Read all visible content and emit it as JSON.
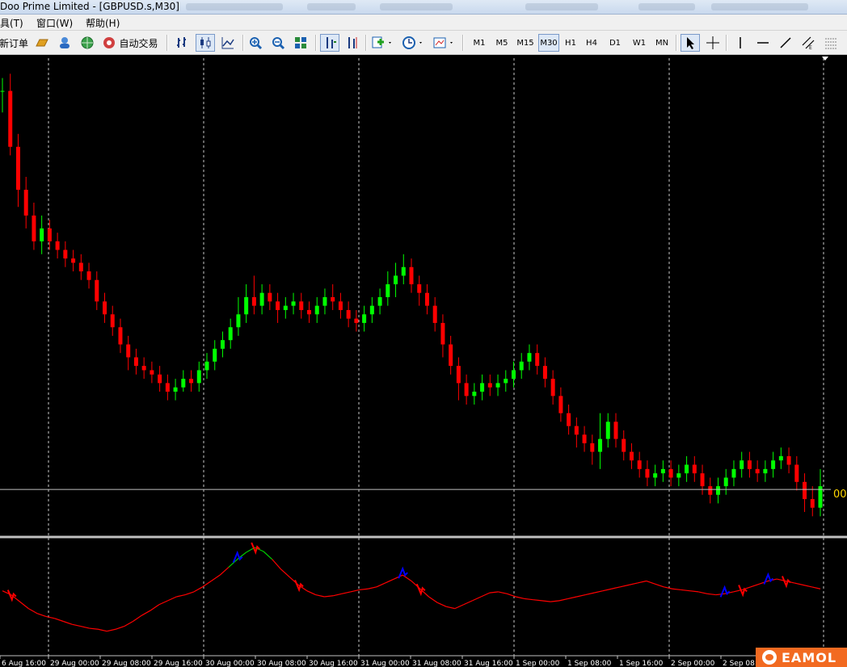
{
  "window": {
    "title": "Doo Prime Limited - [GBPUSD.s,M30]"
  },
  "menu": {
    "items": [
      "具(T)",
      "窗口(W)",
      "帮助(H)"
    ]
  },
  "toolbar": {
    "new_order_label": "新订单",
    "autotrade_label": "自动交易",
    "timeframes": [
      "M1",
      "M5",
      "M15",
      "M30",
      "H1",
      "H4",
      "D1",
      "W1",
      "MN"
    ],
    "active_timeframe": "M30"
  },
  "chart_data": {
    "type": "candlestick",
    "symbol": "GBPUSD.s",
    "timeframe": "M30",
    "price_label": "00",
    "colors": {
      "bull": "#00ff00",
      "bear": "#ff0000",
      "grid": "#c8c8c8",
      "price_line": "#c0c0c0",
      "price_label": "#ffd700",
      "indicator": "#ff0000",
      "indicator_high": "#00cc00",
      "signal_buy": "#0000ff"
    },
    "x_ticks": [
      "6 Aug 16:00",
      "29 Aug 00:00",
      "29 Aug 08:00",
      "29 Aug 16:00",
      "30 Aug 00:00",
      "30 Aug 08:00",
      "30 Aug 16:00",
      "31 Aug 00:00",
      "31 Aug 08:00",
      "31 Aug 16:00",
      "1 Sep 00:00",
      "1 Sep 08:00",
      "1 Sep 16:00",
      "2 Sep 00:00",
      "2 Sep 08:00"
    ],
    "candles": [
      [
        0.95,
        0.95,
        0.98,
        0.9
      ],
      [
        0.95,
        0.82,
        0.99,
        0.8
      ],
      [
        0.82,
        0.72,
        0.85,
        0.68
      ],
      [
        0.72,
        0.66,
        0.75,
        0.63
      ],
      [
        0.66,
        0.6,
        0.69,
        0.58
      ],
      [
        0.6,
        0.63,
        0.66,
        0.57
      ],
      [
        0.63,
        0.6,
        0.65,
        0.58
      ],
      [
        0.6,
        0.58,
        0.62,
        0.56
      ],
      [
        0.58,
        0.56,
        0.6,
        0.54
      ],
      [
        0.56,
        0.55,
        0.58,
        0.53
      ],
      [
        0.55,
        0.53,
        0.57,
        0.51
      ],
      [
        0.53,
        0.51,
        0.55,
        0.49
      ],
      [
        0.51,
        0.46,
        0.53,
        0.44
      ],
      [
        0.46,
        0.43,
        0.48,
        0.41
      ],
      [
        0.43,
        0.4,
        0.45,
        0.38
      ],
      [
        0.4,
        0.36,
        0.42,
        0.34
      ],
      [
        0.36,
        0.33,
        0.38,
        0.3
      ],
      [
        0.33,
        0.31,
        0.35,
        0.29
      ],
      [
        0.31,
        0.3,
        0.33,
        0.28
      ],
      [
        0.3,
        0.29,
        0.32,
        0.27
      ],
      [
        0.29,
        0.27,
        0.31,
        0.25
      ],
      [
        0.27,
        0.25,
        0.29,
        0.23
      ],
      [
        0.25,
        0.26,
        0.28,
        0.23
      ],
      [
        0.26,
        0.28,
        0.3,
        0.25
      ],
      [
        0.28,
        0.27,
        0.3,
        0.25
      ],
      [
        0.27,
        0.3,
        0.32,
        0.25
      ],
      [
        0.3,
        0.32,
        0.34,
        0.28
      ],
      [
        0.32,
        0.35,
        0.37,
        0.3
      ],
      [
        0.35,
        0.37,
        0.39,
        0.33
      ],
      [
        0.37,
        0.4,
        0.42,
        0.35
      ],
      [
        0.4,
        0.43,
        0.47,
        0.38
      ],
      [
        0.43,
        0.47,
        0.5,
        0.41
      ],
      [
        0.47,
        0.45,
        0.52,
        0.43
      ],
      [
        0.45,
        0.48,
        0.5,
        0.43
      ],
      [
        0.48,
        0.46,
        0.5,
        0.44
      ],
      [
        0.46,
        0.44,
        0.48,
        0.41
      ],
      [
        0.44,
        0.45,
        0.47,
        0.42
      ],
      [
        0.45,
        0.46,
        0.48,
        0.43
      ],
      [
        0.46,
        0.44,
        0.48,
        0.42
      ],
      [
        0.44,
        0.43,
        0.46,
        0.41
      ],
      [
        0.43,
        0.45,
        0.47,
        0.41
      ],
      [
        0.45,
        0.47,
        0.49,
        0.43
      ],
      [
        0.47,
        0.46,
        0.5,
        0.44
      ],
      [
        0.46,
        0.44,
        0.48,
        0.42
      ],
      [
        0.44,
        0.42,
        0.46,
        0.4
      ],
      [
        0.42,
        0.41,
        0.44,
        0.39
      ],
      [
        0.41,
        0.43,
        0.45,
        0.39
      ],
      [
        0.43,
        0.45,
        0.47,
        0.41
      ],
      [
        0.45,
        0.47,
        0.49,
        0.43
      ],
      [
        0.47,
        0.5,
        0.53,
        0.45
      ],
      [
        0.5,
        0.52,
        0.55,
        0.47
      ],
      [
        0.52,
        0.54,
        0.57,
        0.5
      ],
      [
        0.54,
        0.5,
        0.56,
        0.48
      ],
      [
        0.5,
        0.48,
        0.52,
        0.45
      ],
      [
        0.48,
        0.45,
        0.5,
        0.43
      ],
      [
        0.45,
        0.41,
        0.47,
        0.39
      ],
      [
        0.41,
        0.36,
        0.43,
        0.33
      ],
      [
        0.36,
        0.31,
        0.38,
        0.29
      ],
      [
        0.31,
        0.27,
        0.33,
        0.23
      ],
      [
        0.27,
        0.24,
        0.29,
        0.22
      ],
      [
        0.24,
        0.25,
        0.27,
        0.22
      ],
      [
        0.25,
        0.27,
        0.29,
        0.23
      ],
      [
        0.27,
        0.26,
        0.29,
        0.24
      ],
      [
        0.26,
        0.27,
        0.29,
        0.24
      ],
      [
        0.27,
        0.28,
        0.3,
        0.25
      ],
      [
        0.28,
        0.3,
        0.32,
        0.26
      ],
      [
        0.3,
        0.32,
        0.34,
        0.28
      ],
      [
        0.32,
        0.34,
        0.36,
        0.3
      ],
      [
        0.34,
        0.31,
        0.36,
        0.29
      ],
      [
        0.31,
        0.28,
        0.33,
        0.26
      ],
      [
        0.28,
        0.24,
        0.3,
        0.22
      ],
      [
        0.24,
        0.2,
        0.26,
        0.18
      ],
      [
        0.2,
        0.17,
        0.22,
        0.15
      ],
      [
        0.17,
        0.15,
        0.19,
        0.12
      ],
      [
        0.15,
        0.13,
        0.17,
        0.11
      ],
      [
        0.13,
        0.11,
        0.15,
        0.08
      ],
      [
        0.11,
        0.14,
        0.2,
        0.07
      ],
      [
        0.14,
        0.18,
        0.2,
        0.12
      ],
      [
        0.18,
        0.14,
        0.2,
        0.12
      ],
      [
        0.14,
        0.11,
        0.16,
        0.09
      ],
      [
        0.11,
        0.09,
        0.13,
        0.07
      ],
      [
        0.09,
        0.07,
        0.11,
        0.05
      ],
      [
        0.07,
        0.05,
        0.09,
        0.03
      ],
      [
        0.05,
        0.06,
        0.08,
        0.03
      ],
      [
        0.06,
        0.07,
        0.09,
        0.04
      ],
      [
        0.07,
        0.05,
        0.09,
        0.03
      ],
      [
        0.05,
        0.06,
        0.08,
        0.03
      ],
      [
        0.06,
        0.08,
        0.1,
        0.04
      ],
      [
        0.08,
        0.06,
        0.1,
        0.04
      ],
      [
        0.06,
        0.03,
        0.08,
        0.01
      ],
      [
        0.03,
        0.01,
        0.05,
        -0.01
      ],
      [
        0.01,
        0.03,
        0.05,
        -0.01
      ],
      [
        0.03,
        0.05,
        0.07,
        0.01
      ],
      [
        0.05,
        0.07,
        0.09,
        0.03
      ],
      [
        0.07,
        0.09,
        0.11,
        0.05
      ],
      [
        0.09,
        0.07,
        0.11,
        0.05
      ],
      [
        0.07,
        0.06,
        0.09,
        0.04
      ],
      [
        0.06,
        0.07,
        0.09,
        0.04
      ],
      [
        0.07,
        0.09,
        0.11,
        0.05
      ],
      [
        0.09,
        0.1,
        0.12,
        0.07
      ],
      [
        0.1,
        0.08,
        0.12,
        0.06
      ],
      [
        0.08,
        0.04,
        0.1,
        0.02
      ],
      [
        0.04,
        0.0,
        0.06,
        -0.03
      ],
      [
        0.0,
        -0.02,
        0.03,
        -0.04
      ],
      [
        -0.02,
        0.03,
        0.07,
        -0.04
      ]
    ],
    "indicator": [
      0.56,
      0.52,
      0.45,
      0.38,
      0.33,
      0.3,
      0.28,
      0.25,
      0.22,
      0.2,
      0.18,
      0.17,
      0.15,
      0.17,
      0.2,
      0.25,
      0.31,
      0.36,
      0.42,
      0.46,
      0.5,
      0.52,
      0.55,
      0.6,
      0.66,
      0.72,
      0.8,
      0.88,
      0.95,
      1.0,
      0.96,
      0.88,
      0.78,
      0.7,
      0.62,
      0.56,
      0.52,
      0.5,
      0.51,
      0.53,
      0.55,
      0.57,
      0.58,
      0.6,
      0.64,
      0.68,
      0.72,
      0.66,
      0.58,
      0.5,
      0.44,
      0.4,
      0.38,
      0.42,
      0.46,
      0.5,
      0.54,
      0.55,
      0.53,
      0.5,
      0.48,
      0.47,
      0.46,
      0.45,
      0.46,
      0.48,
      0.5,
      0.52,
      0.54,
      0.56,
      0.58,
      0.6,
      0.62,
      0.64,
      0.66,
      0.63,
      0.6,
      0.58,
      0.57,
      0.56,
      0.55,
      0.53,
      0.52,
      0.53,
      0.55,
      0.57,
      0.6,
      0.63,
      0.66,
      0.68,
      0.66,
      0.64,
      0.62,
      0.6,
      0.58
    ]
  }
}
